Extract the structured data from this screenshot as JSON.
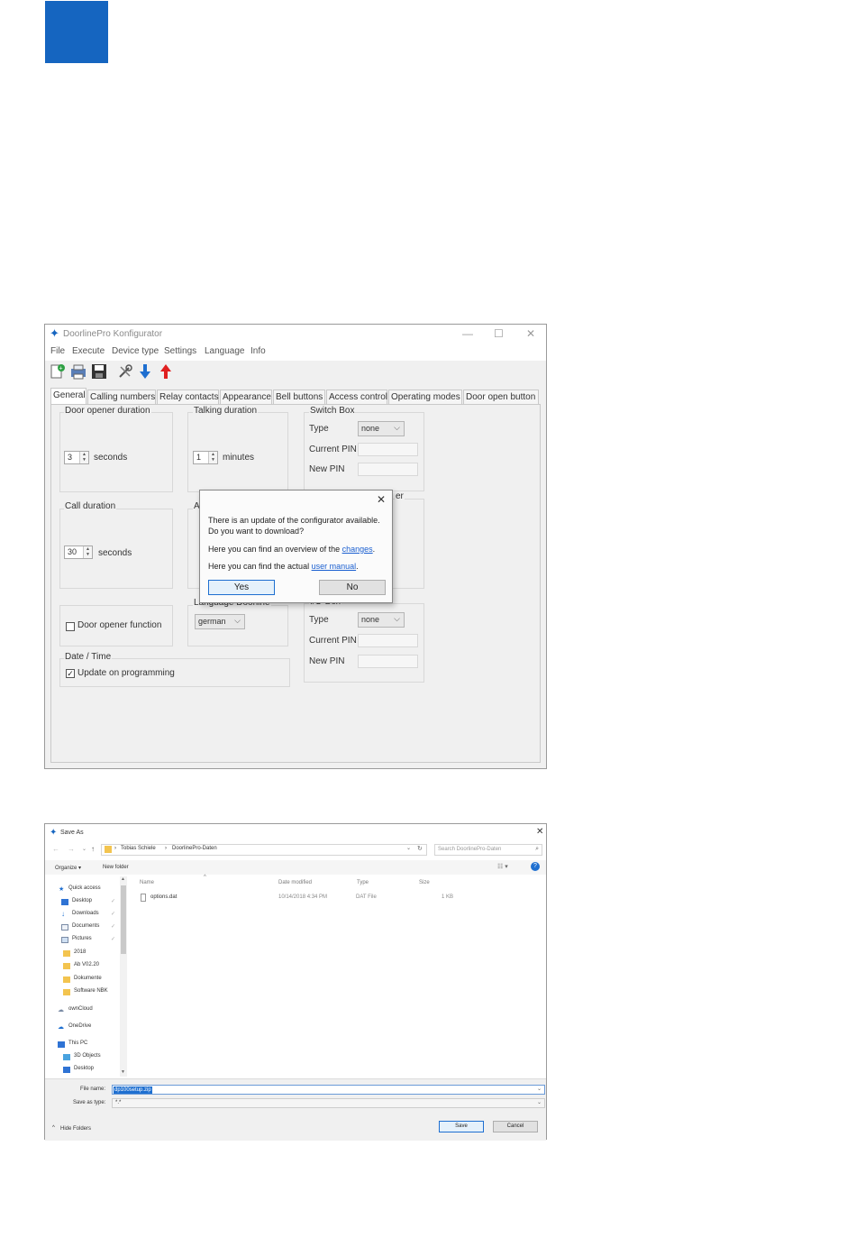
{
  "page": {
    "accent_color": "#1565c0"
  },
  "configurator": {
    "title": "DoorlinePro Konfigurator",
    "menu": [
      "File",
      "Execute",
      "Device type",
      "Settings",
      "Language",
      "Info"
    ],
    "toolbar_icons": [
      "new-file-icon",
      "print-icon",
      "save-icon",
      "tools-icon",
      "download-arrow-icon",
      "upload-arrow-icon"
    ],
    "tabs": [
      "General",
      "Calling numbers",
      "Relay contacts",
      "Appearance",
      "Bell buttons",
      "Access control",
      "Operating modes",
      "Door open button"
    ],
    "active_tab": "General",
    "door_opener": {
      "label": "Door opener duration",
      "value": "3",
      "unit": "seconds"
    },
    "talking": {
      "label": "Talking duration",
      "value": "1",
      "unit": "minutes"
    },
    "switchbox": {
      "label": "Switch Box",
      "type_label": "Type",
      "type_value": "none",
      "current_pin_label": "Current PIN",
      "new_pin_label": "New PIN"
    },
    "call": {
      "label": "Call duration",
      "value": "30",
      "unit": "seconds"
    },
    "partial_labels": {
      "a_group": "A",
      "right_group_tail": "er"
    },
    "door_opener_function": {
      "label": "Door opener function",
      "checked": false
    },
    "language": {
      "label": "Language Doorline",
      "value": "german"
    },
    "iobox": {
      "label": "I/O-Box",
      "type_label": "Type",
      "type_value": "none",
      "current_pin_label": "Current PIN",
      "new_pin_label": "New PIN"
    },
    "datetime": {
      "label": "Date / Time",
      "update_label": "Update on programming",
      "checked": true
    }
  },
  "dialog": {
    "line1": "There is an update of the configurator available.",
    "line2": "Do you want to download?",
    "line3_prefix": "Here you can find an overview of the ",
    "line3_link": "changes",
    "line3_suffix": ".",
    "line4_prefix": "Here you can find the actual ",
    "line4_link": "user manual",
    "line4_suffix": ".",
    "yes": "Yes",
    "no": "No"
  },
  "save_as": {
    "title": "Save As",
    "path": [
      "Tobias Schiele",
      "DoorlinePro-Daten"
    ],
    "search_placeholder": "Search DoorlinePro-Daten",
    "organize": "Organize ▾",
    "new_folder": "New folder",
    "sidebar": [
      {
        "label": "Quick access",
        "icon": "star-icon"
      },
      {
        "label": "Desktop",
        "icon": "desktop-icon",
        "pin": "✓"
      },
      {
        "label": "Downloads",
        "icon": "download-icon",
        "pin": "✓"
      },
      {
        "label": "Documents",
        "icon": "documents-icon",
        "pin": "✓"
      },
      {
        "label": "Pictures",
        "icon": "pictures-icon",
        "pin": "✓"
      },
      {
        "label": "2018",
        "icon": "folder-icon"
      },
      {
        "label": "Ab V02.20",
        "icon": "folder-icon"
      },
      {
        "label": "Dokumente",
        "icon": "folder-icon"
      },
      {
        "label": "Software NBK",
        "icon": "folder-icon"
      },
      {
        "label": "ownCloud",
        "icon": "cloud-icon"
      },
      {
        "label": "OneDrive",
        "icon": "onedrive-icon"
      },
      {
        "label": "This PC",
        "icon": "pc-icon"
      },
      {
        "label": "3D Objects",
        "icon": "cube-icon"
      },
      {
        "label": "Desktop",
        "icon": "desktop-icon"
      }
    ],
    "columns": [
      "Name",
      "Date modified",
      "Type",
      "Size"
    ],
    "files": [
      {
        "name": "options.dat",
        "date": "10/14/2018 4:34 PM",
        "type": "DAT File",
        "size": "1 KB"
      }
    ],
    "file_name_label": "File name:",
    "file_name_value": "dp100setup.zip",
    "save_type_label": "Save as type:",
    "save_type_value": "*.*",
    "hide_folders": "Hide Folders",
    "save_button": "Save",
    "cancel_button": "Cancel"
  }
}
